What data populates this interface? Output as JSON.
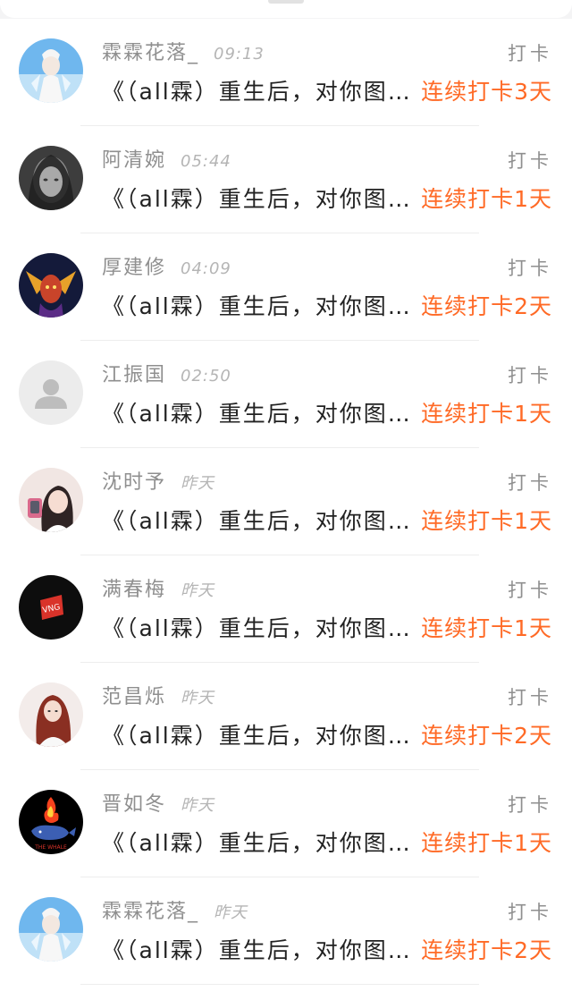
{
  "top_card": {},
  "items": [
    {
      "name": "霖霖花落_",
      "time": "09:13",
      "action": "打卡",
      "book": "《（all霖）重生后，对你图谋不轨》",
      "streak": "连续打卡3天"
    },
    {
      "name": "阿清婉",
      "time": "05:44",
      "action": "打卡",
      "book": "《（all霖）重生后，对你图谋不轨》",
      "streak": "连续打卡1天"
    },
    {
      "name": "厚建修",
      "time": "04:09",
      "action": "打卡",
      "book": "《（all霖）重生后，对你图谋不轨》",
      "streak": "连续打卡2天"
    },
    {
      "name": "江振国",
      "time": "02:50",
      "action": "打卡",
      "book": "《（all霖）重生后，对你图谋不轨》",
      "streak": "连续打卡1天"
    },
    {
      "name": "沈时予",
      "time": "昨天",
      "action": "打卡",
      "book": "《（all霖）重生后，对你图谋不轨》",
      "streak": "连续打卡1天"
    },
    {
      "name": "满春梅",
      "time": "昨天",
      "action": "打卡",
      "book": "《（all霖）重生后，对你图谋不轨》",
      "streak": "连续打卡1天"
    },
    {
      "name": "范昌烁",
      "time": "昨天",
      "action": "打卡",
      "book": "《（all霖）重生后，对你图谋不轨》",
      "streak": "连续打卡2天"
    },
    {
      "name": "晋如冬",
      "time": "昨天",
      "action": "打卡",
      "book": "《（all霖）重生后，对你图谋不轨》",
      "streak": "连续打卡1天"
    },
    {
      "name": "霖霖花落_",
      "time": "昨天",
      "action": "打卡",
      "book": "《（all霖）重生后，对你图谋不轨》",
      "streak": "连续打卡2天"
    }
  ],
  "avatar_badges": {
    "item6": "VNG",
    "item8": "THE WHALE"
  },
  "colors": {
    "accent": "#ff6a26",
    "name": "#8f8f8f",
    "time": "#b5b5b5",
    "text": "#222222",
    "divider": "#ededed"
  }
}
